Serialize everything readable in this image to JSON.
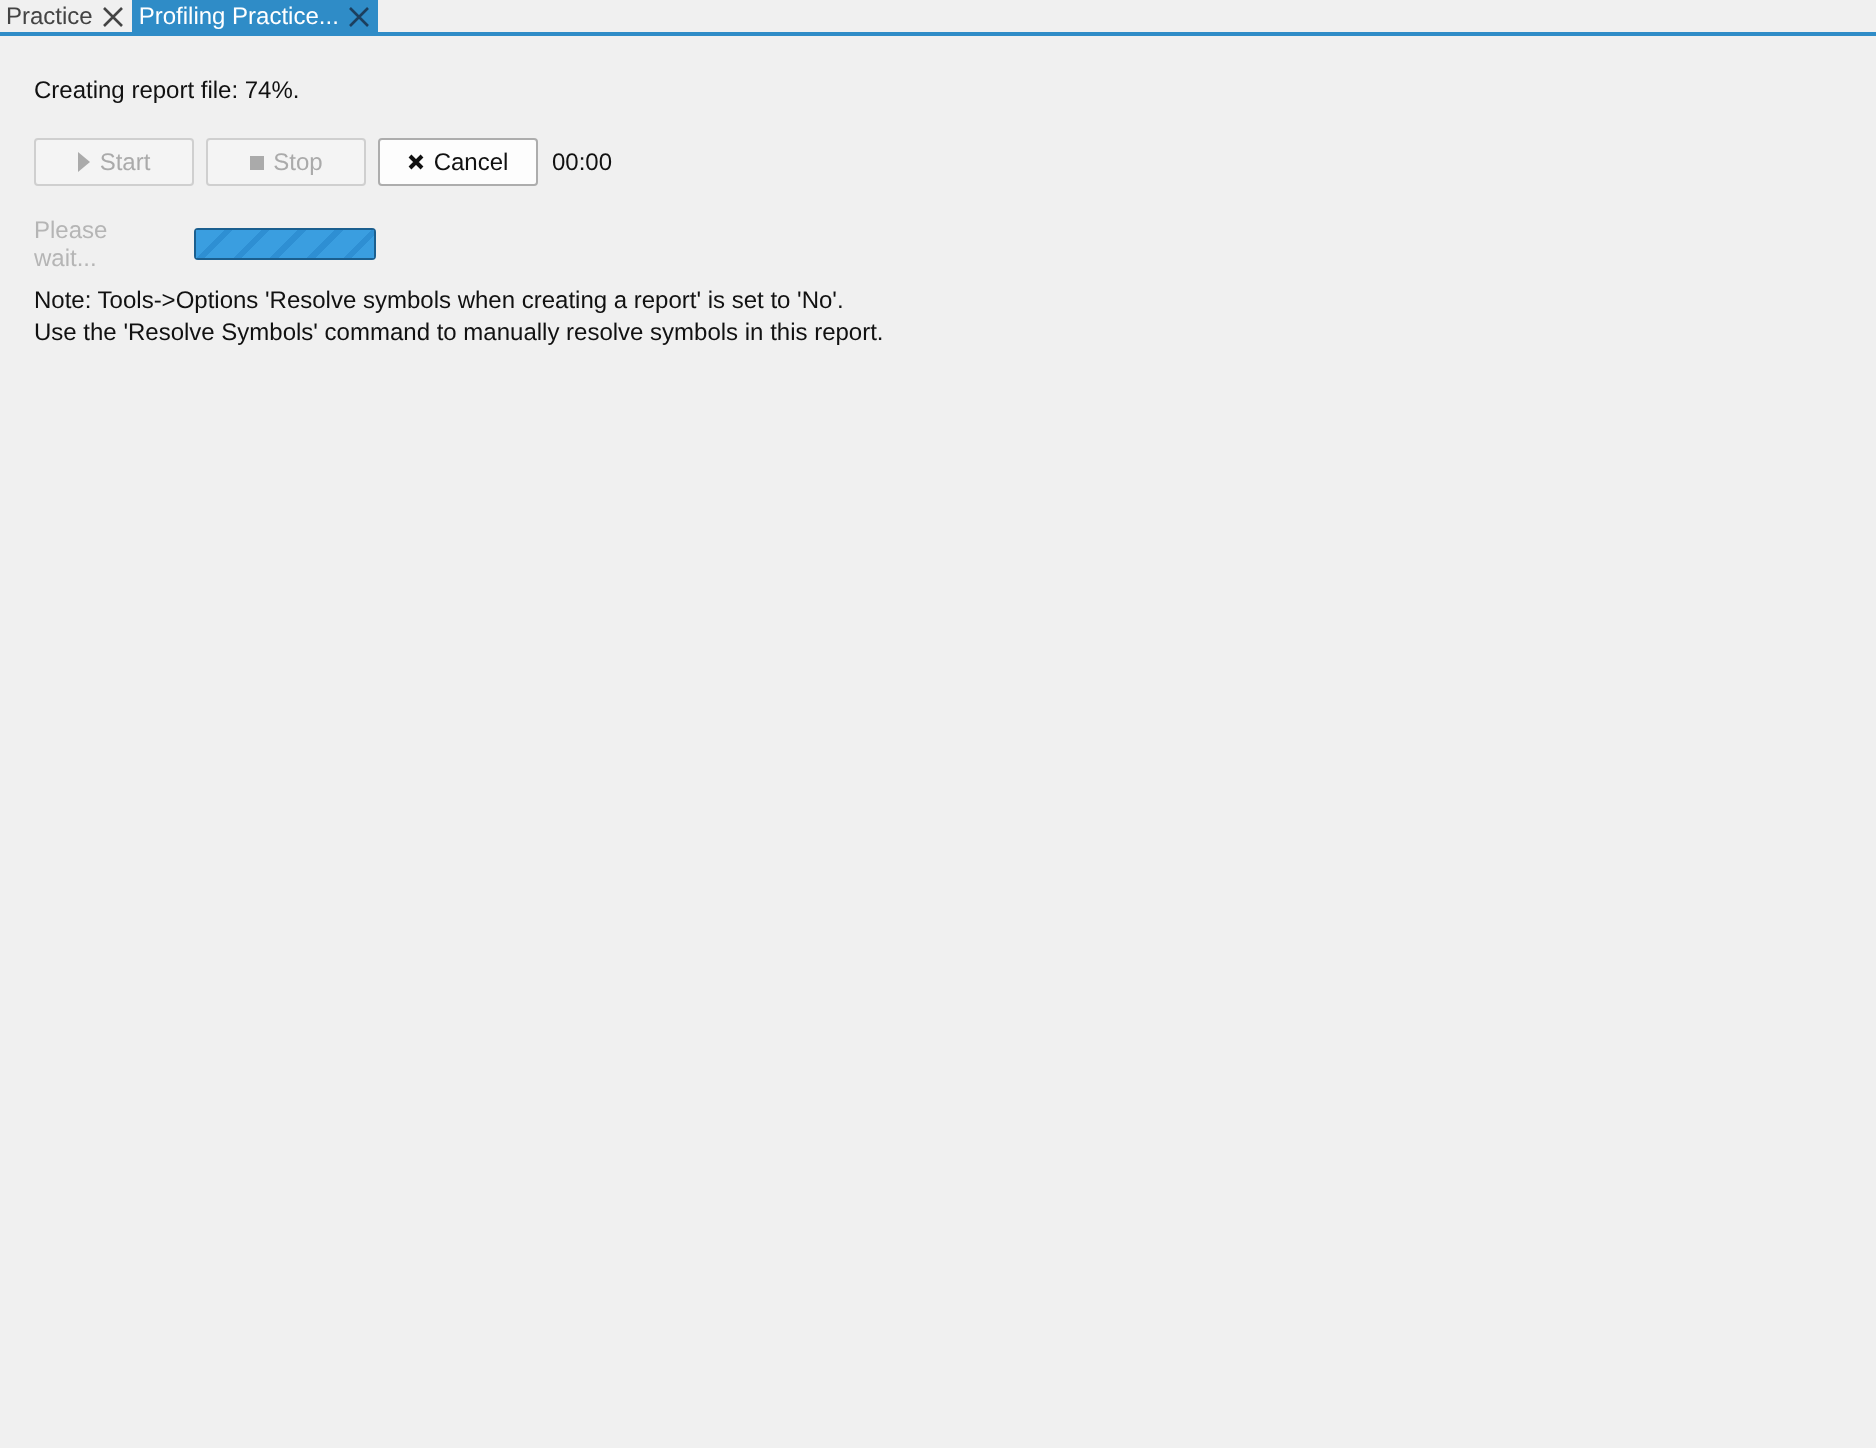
{
  "tabs": [
    {
      "label": "Practice",
      "selected": false
    },
    {
      "label": "Profiling Practice...",
      "selected": true
    }
  ],
  "status": "Creating report file: 74%.",
  "buttons": [
    {
      "kind": "start",
      "label": "Start",
      "disabled": true
    },
    {
      "kind": "stop",
      "label": "Stop",
      "disabled": true
    },
    {
      "kind": "cancel",
      "label": "Cancel",
      "disabled": false
    }
  ],
  "timer": "00:00",
  "progress": {
    "label": "Please wait...",
    "disabled": true,
    "level": 1
  },
  "notes": [
    "Note: Tools->Options 'Resolve symbols when creating a report' is set to 'No'.",
    "Use the 'Resolve Symbols' command to manually resolve symbols in this report."
  ]
}
